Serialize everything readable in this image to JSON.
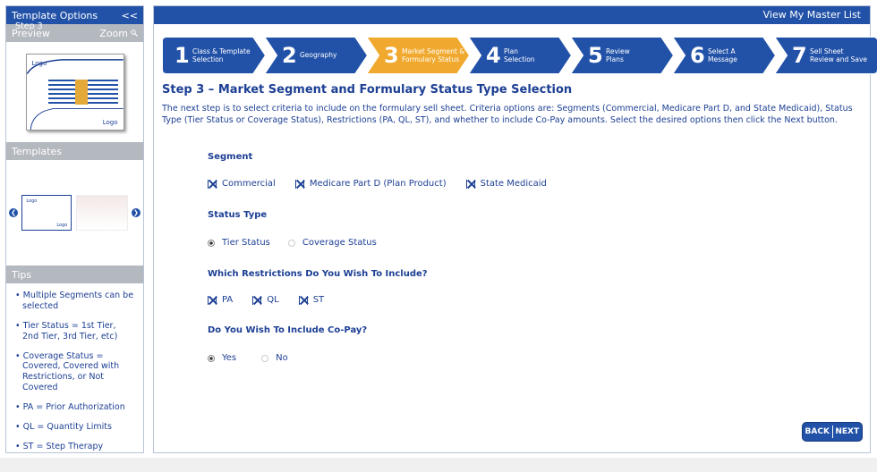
{
  "sidebar": {
    "title": "Template Options",
    "collapse": "<<",
    "preview_label": "Preview",
    "zoom_label": "Zoom",
    "preview_logo_top": "Logo",
    "preview_logo_bottom": "Logo",
    "templates_label": "Templates",
    "tpl_logo_top": "Logo",
    "tpl_logo_bottom": "Logo",
    "tips_label": "Tips",
    "tips_step": "Step 3",
    "tips": [
      "• Multiple Segments can be selected",
      "• Tier Status = 1st Tier, 2nd Tier, 3rd Tier, etc)",
      "• Coverage Status = Covered, Covered with Restrictions, or Not Covered",
      "• PA = Prior Authorization",
      "• QL = Quantity Limits",
      "• ST = Step Therapy"
    ]
  },
  "topbar": {
    "link": "View My Master List"
  },
  "steps": [
    {
      "num": "1",
      "label1": "Class & Template",
      "label2": "Selection",
      "active": false
    },
    {
      "num": "2",
      "label1": "Geography",
      "label2": "",
      "active": false
    },
    {
      "num": "3",
      "label1": "Market Segment &",
      "label2": "Formulary Status",
      "active": true
    },
    {
      "num": "4",
      "label1": "Plan",
      "label2": "Selection",
      "active": false
    },
    {
      "num": "5",
      "label1": "Review",
      "label2": "Plans",
      "active": false
    },
    {
      "num": "6",
      "label1": "Select A",
      "label2": "Message",
      "active": false
    },
    {
      "num": "7",
      "label1": "Sell Sheet",
      "label2": "Review and Save",
      "active": false
    }
  ],
  "colors": {
    "primary": "#2252a8",
    "active": "#f0a92e",
    "text": "#1c3f94"
  },
  "main": {
    "heading": "Step 3 – Market Segment and Formulary Status Type Selection",
    "intro": "The next step is to select criteria to include on the formulary sell sheet.  Criteria options are: Segments (Commercial, Medicare Part D, and State Medicaid), Status Type (Tier Status or Coverage Status), Restrictions (PA, QL, ST), and whether to include Co-Pay amounts.  Select the desired options then click the Next button.",
    "segment_title": "Segment",
    "segments": [
      "Commercial",
      "Medicare Part D (Plan Product)",
      "State Medicaid"
    ],
    "status_title": "Status Type",
    "status_options": [
      "Tier Status",
      "Coverage Status"
    ],
    "status_selected": "Tier Status",
    "restrictions_title": "Which Restrictions Do You Wish To Include?",
    "restrictions": [
      "PA",
      "QL",
      "ST"
    ],
    "copay_title": "Do You Wish To Include Co-Pay?",
    "copay_options": [
      "Yes",
      "No"
    ],
    "copay_selected": "Yes",
    "back_label": "BACK",
    "next_label": "NEXT"
  }
}
